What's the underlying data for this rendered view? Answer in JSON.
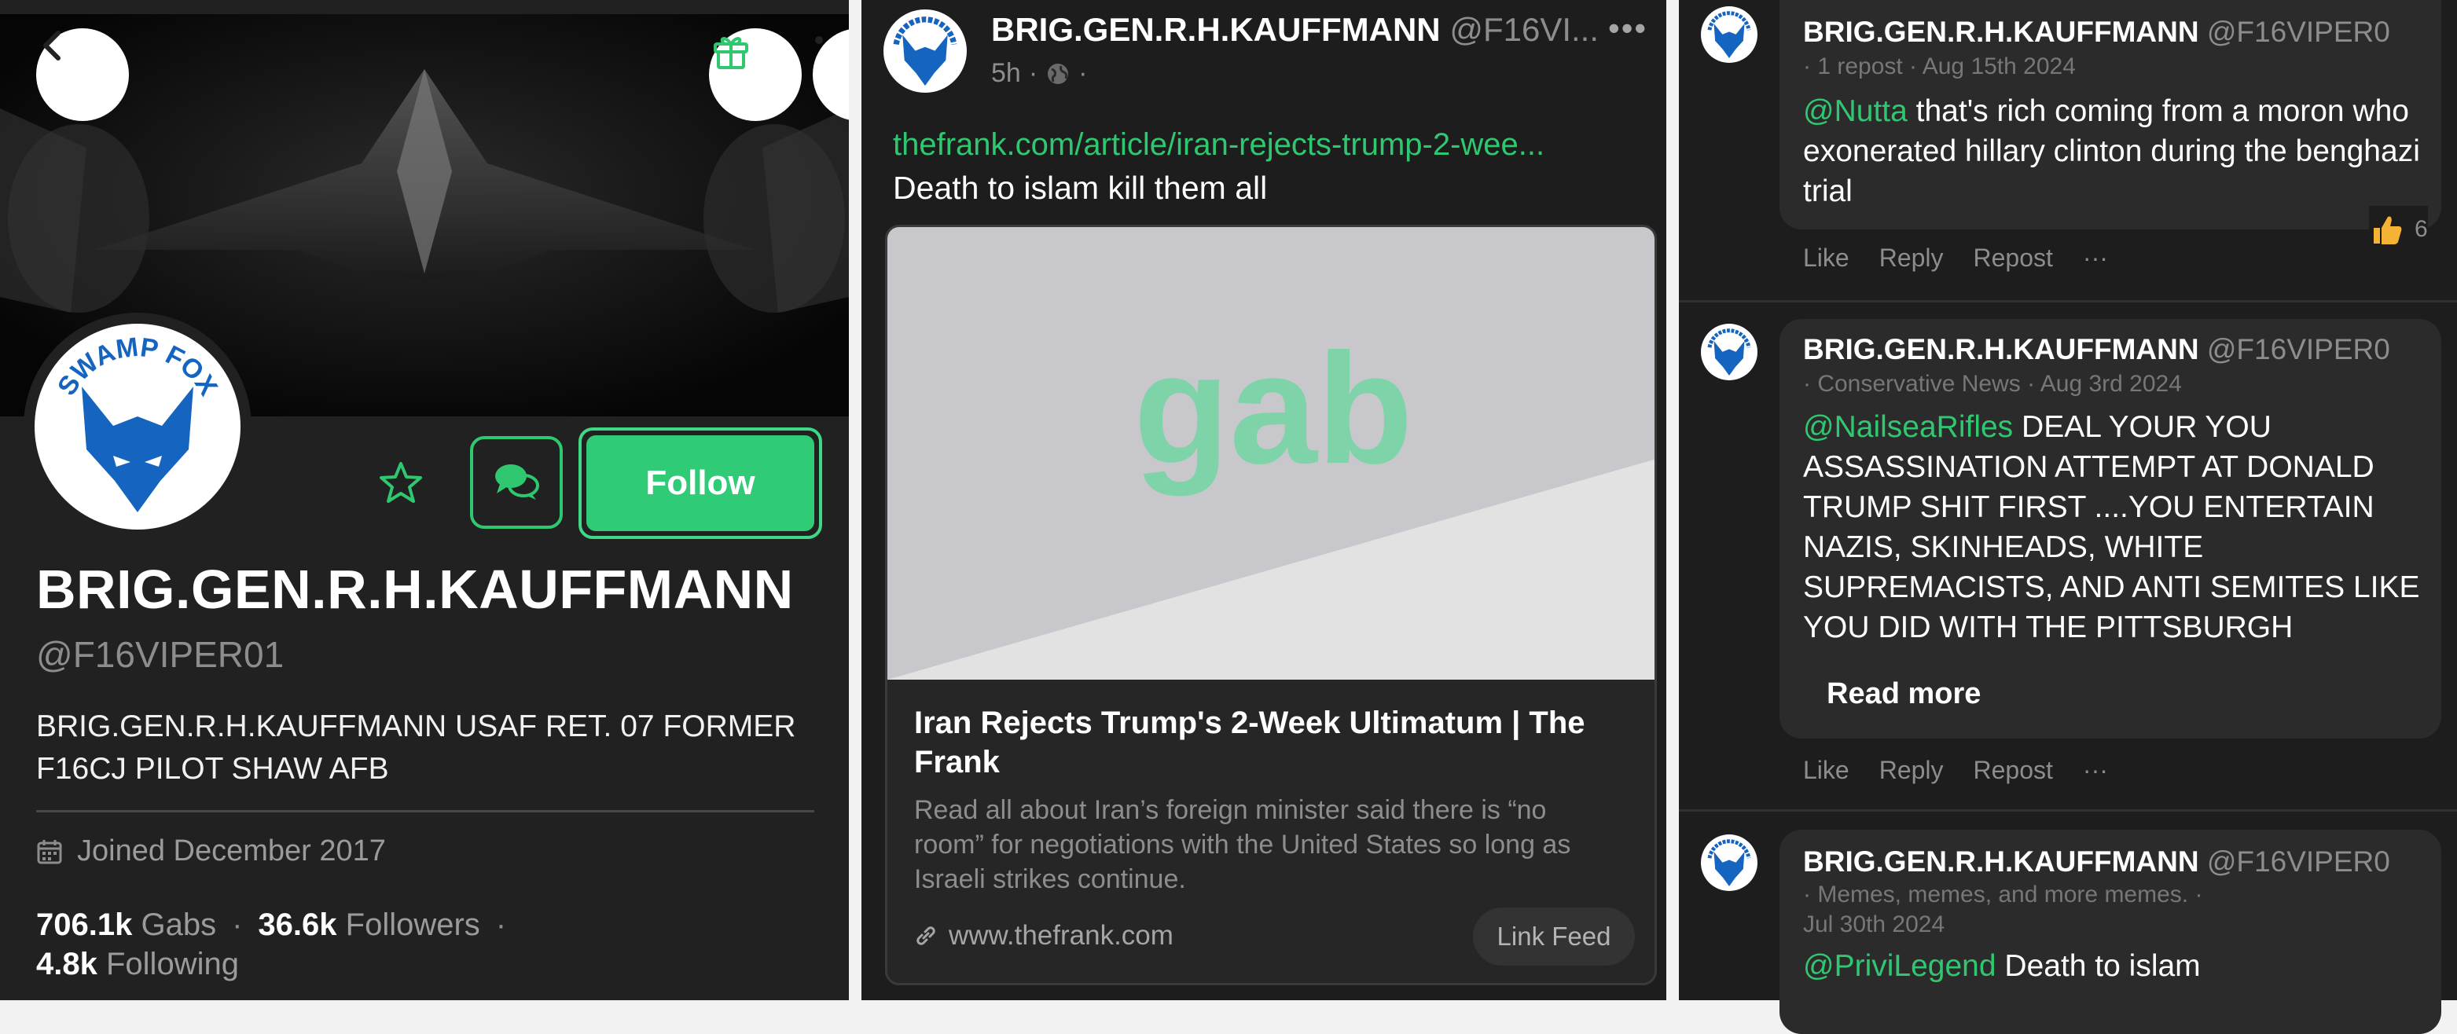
{
  "profile": {
    "name": "BRIG.GEN.R.H.KAUFFMANN",
    "handle": "@F16VIPER01",
    "bio": "BRIG.GEN.R.H.KAUFFMANN USAF RET. 07 FORMER F16CJ PILOT SHAW AFB",
    "joined": "Joined December 2017",
    "avatar_text": "SWAMP FOX",
    "follow_label": "Follow",
    "stats": {
      "gabs_count": "706.1k",
      "gabs_label": "Gabs",
      "followers_count": "36.6k",
      "followers_label": "Followers",
      "following_count": "4.8k",
      "following_label": "Following"
    },
    "icons": [
      "back-arrow-icon",
      "gift-icon",
      "more-icon",
      "star-icon",
      "chat-icon",
      "calendar-icon"
    ]
  },
  "post": {
    "author": "BRIG.GEN.R.H.KAUFFMANN",
    "handle": "@F16VI...",
    "time": "5h",
    "link": "thefrank.com/article/iran-rejects-trump-2-wee...",
    "text": "Death to islam kill them all",
    "card": {
      "image_text": "gab",
      "title": "Iran Rejects Trump's 2-Week Ultimatum | The Frank",
      "description": "Read all about Iran’s foreign minister said there is “no room” for negotiations with the United States so long as Israeli strikes continue.",
      "url": "www.thefrank.com",
      "button": "Link Feed"
    }
  },
  "comments": [
    {
      "author": "BRIG.GEN.R.H.KAUFFMANN",
      "handle": "@F16VIPER0",
      "meta": "· 1 repost · Aug 15th 2024",
      "mention": "@Nutta",
      "text": " that's rich coming from a moron who exonerated hillary clinton during the benghazi trial",
      "reaction_count": "6"
    },
    {
      "author": "BRIG.GEN.R.H.KAUFFMANN",
      "handle": "@F16VIPER0",
      "meta": "· Conservative News · Aug 3rd 2024",
      "mention": "@NailseaRifles",
      "text": " DEAL YOUR YOU ASSASSINATION ATTEMPT AT DONALD TRUMP SHIT FIRST ....YOU ENTERTAIN NAZIS, SKINHEADS, WHITE SUPREMACISTS, AND ANTI SEMITES LIKE YOU DID WITH THE PITTSBURGH",
      "read_more": "Read more"
    },
    {
      "author": "BRIG.GEN.R.H.KAUFFMANN",
      "handle": "@F16VIPER0",
      "meta1": "· Memes, memes, and more memes. ·",
      "meta2": "Jul 30th 2024",
      "mention": "@PriviLegend",
      "text": " Death to islam"
    }
  ],
  "actions": {
    "like": "Like",
    "reply": "Reply",
    "repost": "Repost",
    "more": "···"
  },
  "colors": {
    "accent": "#2fcb77",
    "background": "#1f1f1f",
    "bubble": "#2b2b2b",
    "muted": "#8d8d8d"
  }
}
